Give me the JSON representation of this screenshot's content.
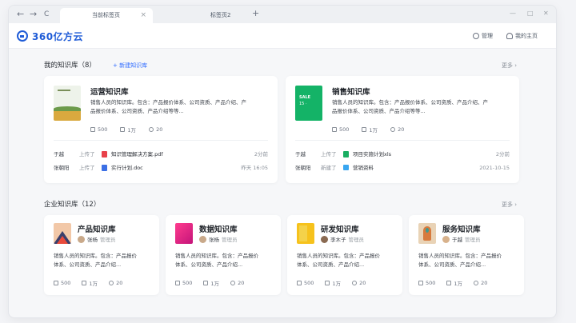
{
  "browser": {
    "tabs": [
      {
        "label": "当前标签页",
        "close": "×"
      },
      {
        "label": "标签页2"
      }
    ],
    "new_tab": "+",
    "nav": {
      "back": "←",
      "forward": "→",
      "reload": "C"
    },
    "window_controls": {
      "min": "—",
      "max": "□",
      "close": "✕"
    }
  },
  "header": {
    "logo_text": "360亿方云",
    "manage_label": "管理",
    "home_label": "我的主页"
  },
  "my_kb": {
    "title": "我的知识库（8）",
    "new_label": "+ 新建知识库",
    "more_label": "更多 ›",
    "cards": [
      {
        "title": "运营知识库",
        "desc_lines": [
          "销售人员的知识库。包含：产品报价体系、公司资质、产品介绍、产",
          "品报价体系、公司资质、产品介绍等等..."
        ],
        "stats": {
          "docs": "500",
          "views": "1万",
          "members": "20"
        },
        "activities": [
          {
            "user": "于越",
            "verb": "上传了",
            "file": "知识管理解决方案.pdf",
            "time": "2分前",
            "file_color": "#e8414a"
          },
          {
            "user": "张朝阳",
            "verb": "上传了",
            "file": "实行计划.doc",
            "time": "昨天 16:05",
            "file_color": "#3b6fe5"
          }
        ]
      },
      {
        "title": "销售知识库",
        "desc_lines": [
          "销售人员的知识库。包含：产品报价体系、公司资质、产品介绍、产",
          "品报价体系、公司资质、产品介绍等等..."
        ],
        "stats": {
          "docs": "500",
          "views": "1万",
          "members": "20"
        },
        "activities": [
          {
            "user": "于越",
            "verb": "上传了",
            "file": "项目实施计划xls",
            "time": "2分前",
            "file_color": "#1aae62"
          },
          {
            "user": "张朝阳",
            "verb": "新建了",
            "file": "营销资料",
            "time": "2021-10-15",
            "file_color": "#39a6f0"
          }
        ]
      }
    ]
  },
  "ent_kb": {
    "title": "企业知识库（12）",
    "more_label": "更多 ›",
    "cards": [
      {
        "title": "产品知识库",
        "owner": "张杨",
        "role": "管理员",
        "desc_lines": [
          "销售人员的知识库。包含：产品报价",
          "体系、公司资质、产品介绍..."
        ],
        "stats": {
          "docs": "500",
          "views": "1万",
          "members": "20"
        }
      },
      {
        "title": "数据知识库",
        "owner": "张杨",
        "role": "管理员",
        "desc_lines": [
          "销售人员的知识库。包含：产品报价",
          "体系、公司资质、产品介绍..."
        ],
        "stats": {
          "docs": "500",
          "views": "1万",
          "members": "20"
        }
      },
      {
        "title": "研发知识库",
        "owner": "李木子",
        "role": "管理员",
        "desc_lines": [
          "销售人员的知识库。包含：产品报价",
          "体系、公司资质、产品介绍..."
        ],
        "stats": {
          "docs": "500",
          "views": "1万",
          "members": "20"
        }
      },
      {
        "title": "服务知识库",
        "owner": "于越",
        "role": "管理员",
        "desc_lines": [
          "销售人员的知识库。包含：产品报价",
          "体系、公司资质、产品介绍..."
        ],
        "stats": {
          "docs": "500",
          "views": "1万",
          "members": "20"
        }
      }
    ]
  },
  "colors": {
    "brand": "#1e5bd7",
    "link": "#2f6bff"
  }
}
